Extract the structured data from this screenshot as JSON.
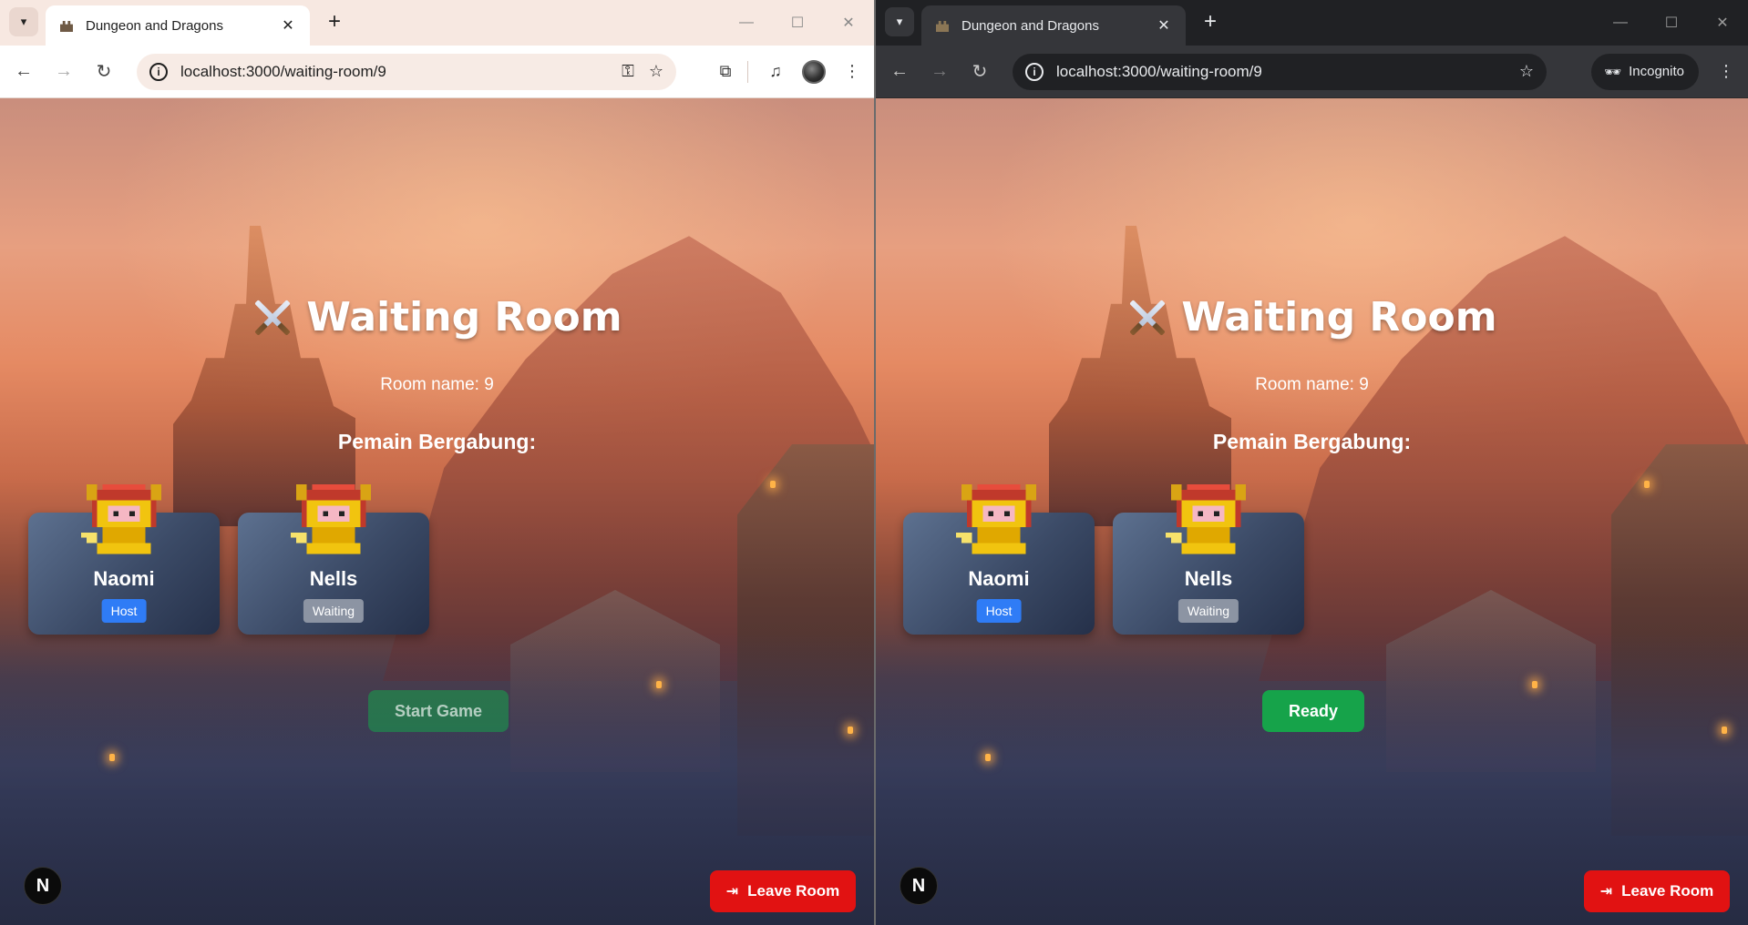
{
  "left_window": {
    "theme": "light",
    "tab": {
      "title": "Dungeon and Dragons"
    },
    "address": {
      "url": "localhost:3000/waiting-room/9"
    },
    "page": {
      "title": "Waiting Room",
      "room_name": "Room name: 9",
      "players_heading": "Pemain Bergabung:",
      "players": [
        {
          "name": "Naomi",
          "status": "Host"
        },
        {
          "name": "Nells",
          "status": "Waiting"
        }
      ],
      "action_button": "Start Game",
      "leave_button": "Leave Room",
      "dev_badge": "N"
    }
  },
  "right_window": {
    "theme": "dark",
    "tab": {
      "title": "Dungeon and Dragons"
    },
    "address": {
      "url": "localhost:3000/waiting-room/9"
    },
    "incognito_label": "Incognito",
    "page": {
      "title": "Waiting Room",
      "room_name": "Room name: 9",
      "players_heading": "Pemain Bergabung:",
      "players": [
        {
          "name": "Naomi",
          "status": "Host"
        },
        {
          "name": "Nells",
          "status": "Waiting"
        }
      ],
      "action_button": "Ready",
      "leave_button": "Leave Room",
      "dev_badge": "N"
    }
  },
  "icons": {
    "title_icon": "crossed-swords-icon",
    "player_sprite": "pixel-knight-icon"
  },
  "colors": {
    "host_badge": "#2f7cf6",
    "waiting_badge": "#8c94a3",
    "ready_button": "#16a34a",
    "leave_button": "#e11212"
  }
}
